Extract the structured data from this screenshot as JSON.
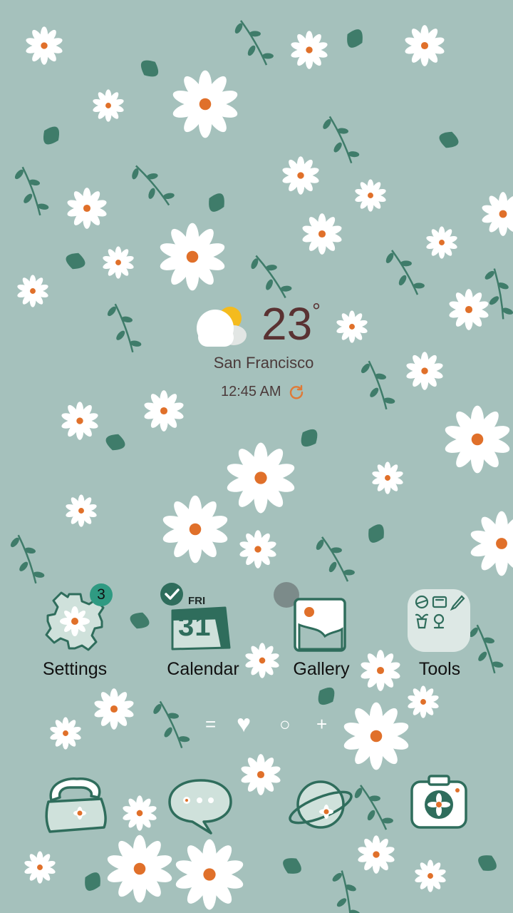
{
  "weather": {
    "temperature": "23",
    "unit": "°",
    "city": "San Francisco",
    "time": "12:45 AM",
    "condition_icon": "partly-sunny-icon"
  },
  "apps": [
    {
      "name": "settings",
      "label": "Settings",
      "icon": "gear-icon",
      "badge": "3"
    },
    {
      "name": "calendar",
      "label": "Calendar",
      "icon": "calendar-icon",
      "day": "FRI",
      "date": "31"
    },
    {
      "name": "gallery",
      "label": "Gallery",
      "icon": "gallery-icon"
    },
    {
      "name": "tools",
      "label": "Tools",
      "icon": "folder-icon"
    }
  ],
  "pager": {
    "items": [
      "=",
      "♥",
      "○",
      "+"
    ]
  },
  "dock": [
    {
      "name": "phone",
      "icon": "phone-icon"
    },
    {
      "name": "messages",
      "icon": "message-bubble-icon"
    },
    {
      "name": "internet",
      "icon": "planet-icon"
    },
    {
      "name": "camera",
      "icon": "camera-icon"
    }
  ],
  "colors": {
    "background": "#a5c1bc",
    "leaf": "#3f7c6a",
    "daisy_center": "#e0702a",
    "icon_stroke": "#2f6d5c",
    "badge": "#2f9a82"
  }
}
